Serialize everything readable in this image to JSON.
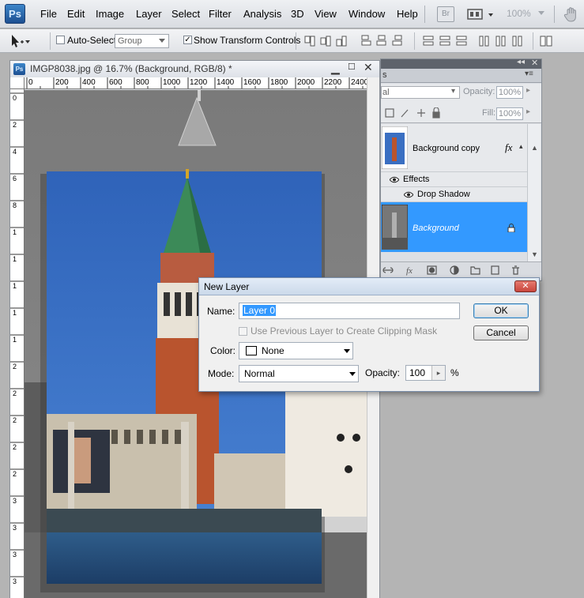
{
  "app": {
    "logo": "Ps"
  },
  "menu": [
    "File",
    "Edit",
    "Image",
    "Layer",
    "Select",
    "Filter",
    "Analysis",
    "3D",
    "View",
    "Window",
    "Help"
  ],
  "appbar": {
    "bridge_label": "Br",
    "zoom": "100%"
  },
  "options": {
    "auto_select_label": "Auto-Select:",
    "auto_select_checked": false,
    "auto_select_target": "Group",
    "show_transform_label": "Show Transform Controls",
    "show_transform_checked": true
  },
  "document": {
    "title": "IMGP8038.jpg @ 16.7% (Background, RGB/8) *",
    "ruler_h": [
      "0",
      "200",
      "400",
      "600",
      "800",
      "1000",
      "1200",
      "1400",
      "1600",
      "1800",
      "2000",
      "2200",
      "2400"
    ],
    "ruler_v": [
      "0",
      "2",
      "4",
      "6",
      "8",
      "1",
      "1",
      "1",
      "1",
      "1",
      "2",
      "2",
      "2",
      "2",
      "2",
      "3",
      "3",
      "3",
      "3"
    ]
  },
  "panel": {
    "tab_fragment": "s",
    "blend_fragment": "al",
    "opacity_label": "Opacity:",
    "opacity": "100%",
    "fill_label": "Fill:",
    "fill": "100%",
    "layers": [
      {
        "name": "Background copy",
        "fx": "fx",
        "selected": false
      },
      {
        "name": "Effects",
        "indent": 1
      },
      {
        "name": "Drop Shadow",
        "indent": 2
      },
      {
        "name": "Background",
        "selected": true,
        "locked": true
      }
    ]
  },
  "dialog": {
    "title": "New Layer",
    "name_label": "Name:",
    "name_value": "Layer 0",
    "clip_label": "Use Previous Layer to Create Clipping Mask",
    "clip_checked": false,
    "color_label": "Color:",
    "color_value": "None",
    "mode_label": "Mode:",
    "mode_value": "Normal",
    "opacity_label": "Opacity:",
    "opacity_value": "100",
    "opacity_unit": "%",
    "ok_label": "OK",
    "cancel_label": "Cancel"
  },
  "colors": {
    "selection": "#3399ff",
    "dialog_close": "#c9463d",
    "ps_blue": "#2a64a8"
  }
}
